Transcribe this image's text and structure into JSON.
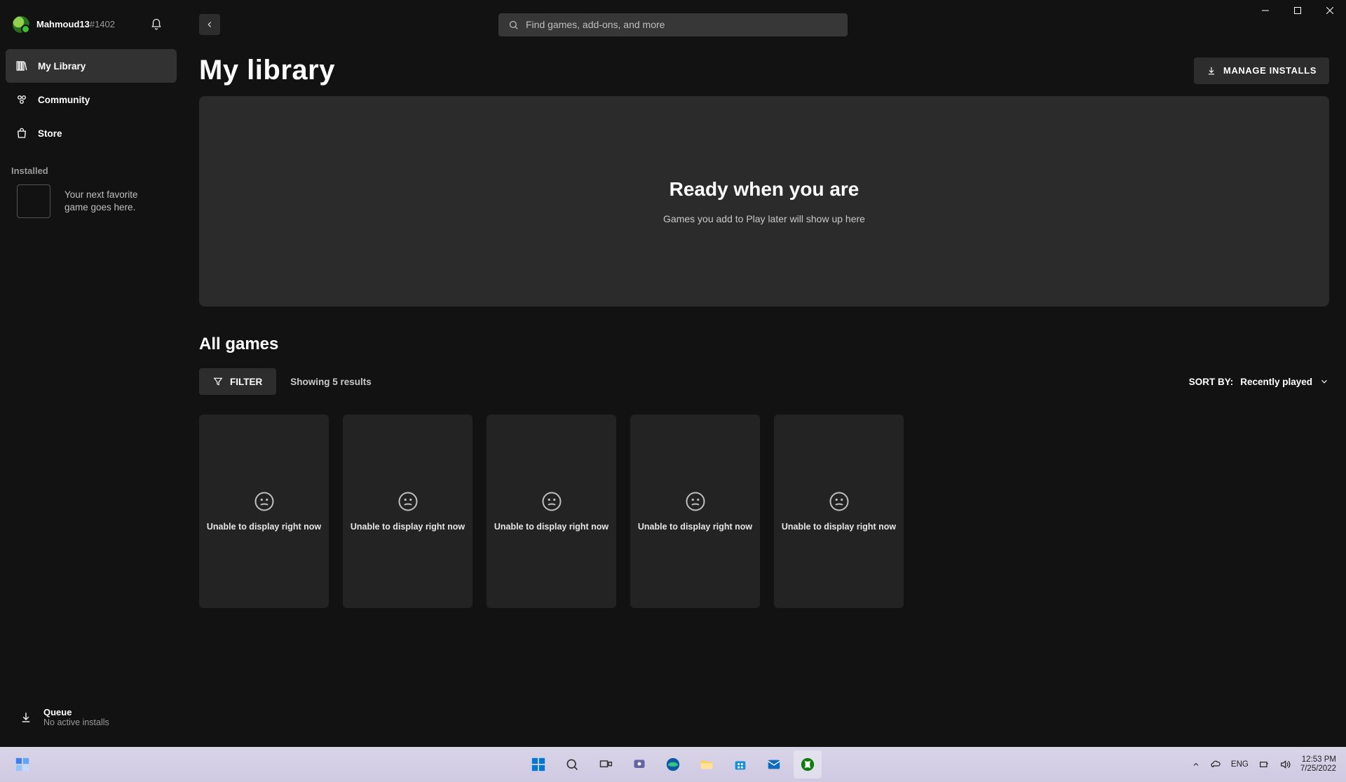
{
  "user": {
    "name": "Mahmoud13",
    "tag": "#1402"
  },
  "search": {
    "placeholder": "Find games, add-ons, and more"
  },
  "sidebar": {
    "nav": [
      {
        "label": "My Library"
      },
      {
        "label": "Community"
      },
      {
        "label": "Store"
      }
    ],
    "installed_label": "Installed",
    "placeholder_text": "Your next favorite game goes here.",
    "queue": {
      "title": "Queue",
      "sub": "No active installs"
    }
  },
  "page_title": "My library",
  "manage_installs": "MANAGE INSTALLS",
  "hero": {
    "title": "Ready when you are",
    "subtitle": "Games you add to Play later will show up here"
  },
  "all_games": {
    "title": "All games",
    "filter_label": "FILTER",
    "results": "Showing 5 results",
    "sort_prefix": "SORT BY:",
    "sort_value": "Recently played",
    "card_text": "Unable to display right now",
    "count": 5
  },
  "taskbar": {
    "lang": "ENG",
    "time": "12:53 PM",
    "date": "7/25/2022"
  }
}
